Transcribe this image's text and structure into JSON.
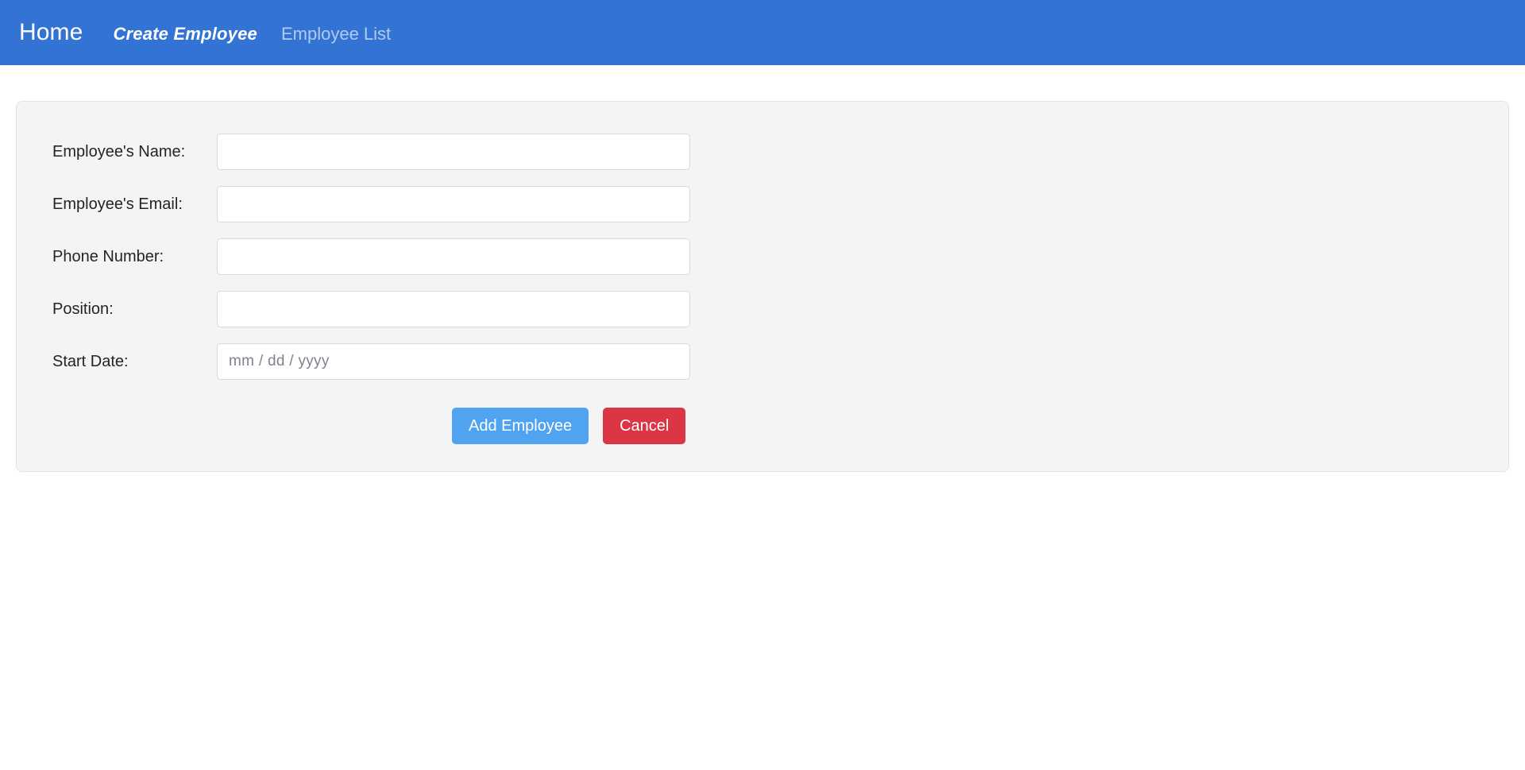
{
  "navbar": {
    "background_color": "#3273d4",
    "brand": "Home",
    "links": [
      {
        "label": "Create Employee",
        "state": "active"
      },
      {
        "label": "Employee List",
        "state": "inactive"
      }
    ]
  },
  "form": {
    "fields": [
      {
        "label": "Employee's Name:",
        "type": "text",
        "value": "",
        "placeholder": ""
      },
      {
        "label": "Employee's Email:",
        "type": "text",
        "value": "",
        "placeholder": ""
      },
      {
        "label": "Phone Number:",
        "type": "text",
        "value": "",
        "placeholder": ""
      },
      {
        "label": "Position:",
        "type": "text",
        "value": "",
        "placeholder": ""
      },
      {
        "label": "Start Date:",
        "type": "date",
        "value": "",
        "placeholder": "mm / dd / yyyy"
      }
    ],
    "buttons": {
      "submit_label": "Add Employee",
      "submit_color": "#4fa3f0",
      "cancel_label": "Cancel",
      "cancel_color": "#dc3545"
    },
    "card_background": "#f4f4f4"
  }
}
